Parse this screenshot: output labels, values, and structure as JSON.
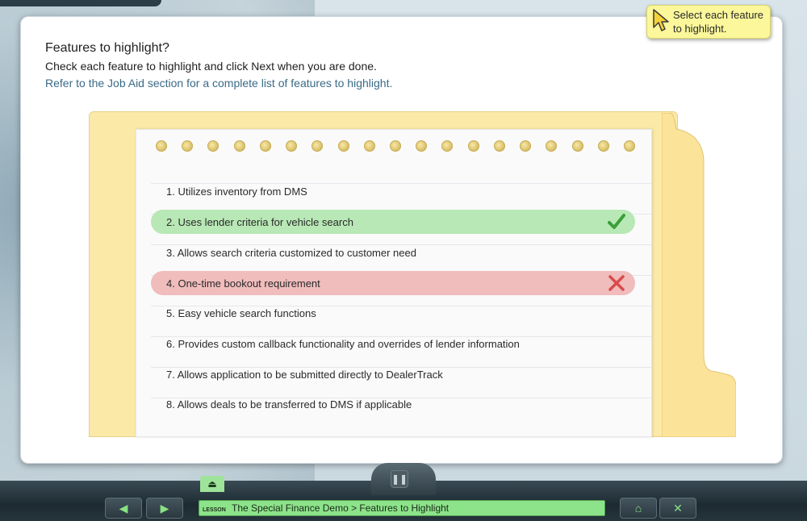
{
  "header": {
    "heading": "Features to highlight?",
    "instructions": "Check each feature to highlight and click Next when you are done.",
    "job_aid": "Refer to the Job Aid section for a complete list of features to highlight."
  },
  "tooltip": {
    "text": "Select each feature to highlight."
  },
  "features": [
    {
      "label": "1. Utilizes inventory from DMS",
      "state": "none"
    },
    {
      "label": "2. Uses lender criteria for vehicle search",
      "state": "correct"
    },
    {
      "label": "3. Allows search criteria customized to customer need",
      "state": "none"
    },
    {
      "label": "4. One-time bookout requirement",
      "state": "wrong"
    },
    {
      "label": "5. Easy vehicle search functions",
      "state": "none"
    },
    {
      "label": "6. Provides custom callback functionality and overrides of lender information",
      "state": "none"
    },
    {
      "label": "7. Allows application to be submitted directly to DealerTrack",
      "state": "none"
    },
    {
      "label": "8. Allows deals to be transferred to DMS if applicable",
      "state": "none"
    }
  ],
  "bottom_bar": {
    "lesson_tag": "LESSON",
    "breadcrumb": "The Special Finance Demo > Features to Highlight",
    "prev_icon": "arrow-left-icon",
    "next_icon": "arrow-right-icon",
    "home_icon": "home-icon",
    "exit_icon": "close-icon",
    "pause_icon": "pause-icon",
    "eject_icon": "eject-icon"
  },
  "colors": {
    "correct": "#b8e8b5",
    "wrong": "#f0bcbc",
    "accent_green": "#8de38a",
    "link_blue": "#3a6a86"
  }
}
